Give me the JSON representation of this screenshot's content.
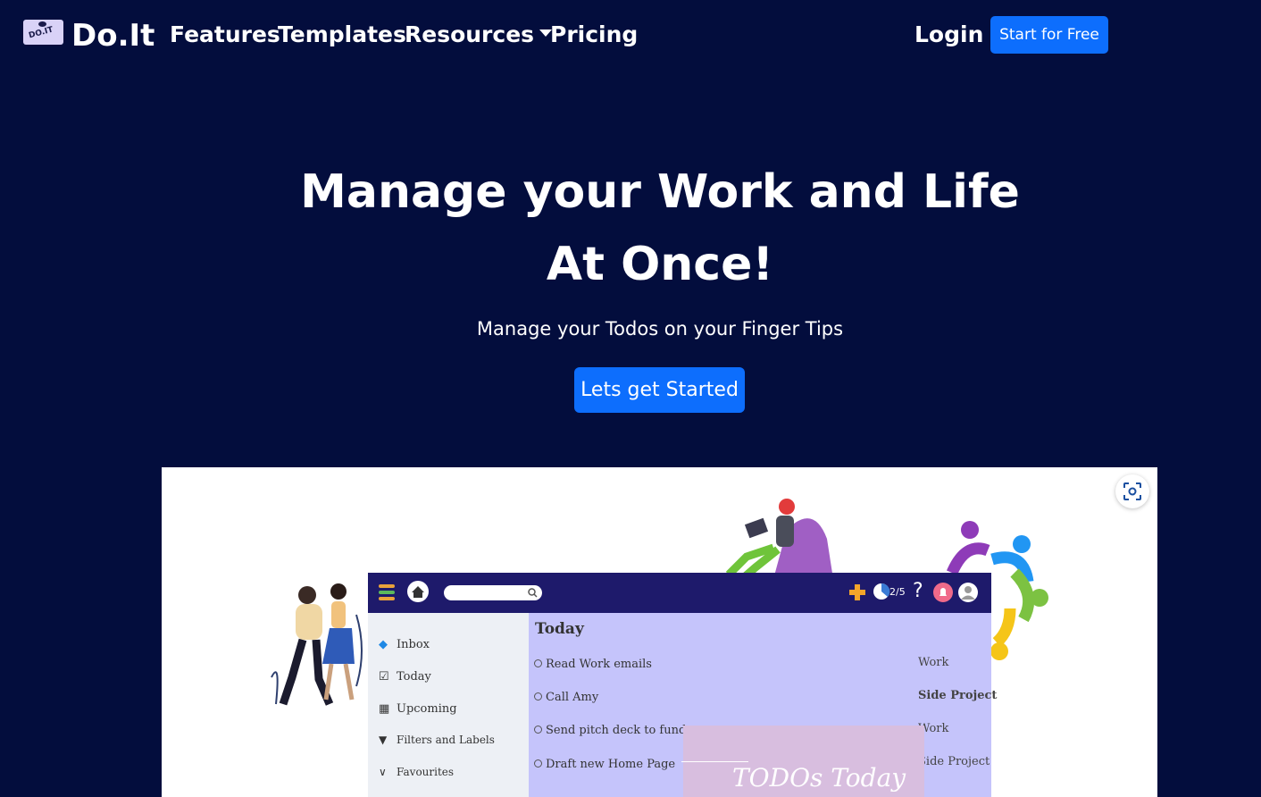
{
  "brand": {
    "logo_text": "DO.IT",
    "name": "Do.It"
  },
  "nav": {
    "links": [
      "Features",
      "Templates",
      "Resources",
      "Pricing"
    ],
    "login": "Login",
    "cta": "Start for Free"
  },
  "hero": {
    "title_line1": "Manage your Work and Life",
    "title_line2": "At Once!",
    "subtitle": "Manage your Todos on your Finger Tips",
    "button": "Lets get Started"
  },
  "app_preview": {
    "counter": "2/5",
    "help": "?",
    "sidebar": [
      "Inbox",
      "Today",
      "Upcoming",
      "Filters and Labels",
      "Favourites"
    ],
    "main_title": "Today",
    "tasks": [
      "Read Work emails",
      "Call Amy",
      "Send pitch deck to fund ra",
      "Draft new Home Page"
    ],
    "projects": [
      "Work",
      "Side Project",
      "Work",
      "Side Project"
    ],
    "overlay_text": "TODOs Today"
  },
  "colors": {
    "background": "#030d3d",
    "accent": "#0d6efd"
  }
}
